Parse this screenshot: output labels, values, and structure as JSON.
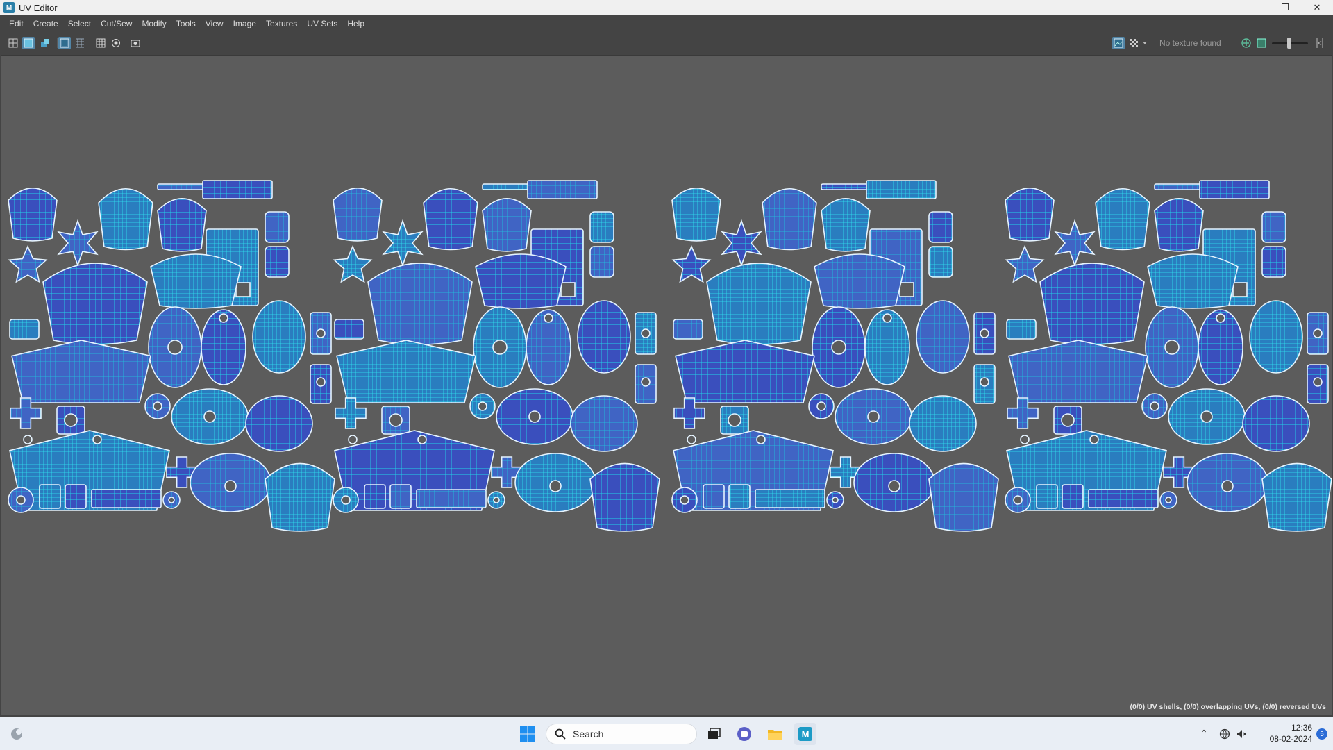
{
  "window": {
    "title": "UV Editor"
  },
  "window_controls": {
    "minimize": "—",
    "restore": "❐",
    "close": "✕"
  },
  "menu": [
    "Edit",
    "Create",
    "Select",
    "Cut/Sew",
    "Modify",
    "Tools",
    "View",
    "Image",
    "Textures",
    "UV Sets",
    "Help"
  ],
  "toolbar": {
    "texture_status": "No texture found"
  },
  "viewport": {
    "status": "(0/0) UV shells, (0/0) overlapping UVs, (0/0) reversed UVs"
  },
  "colors": {
    "uv_fill": "#3a4fbd",
    "uv_wire": "#22d3e6",
    "uv_border": "#e6f4ff",
    "viewport_bg": "#5c5c5c"
  },
  "taskbar": {
    "search_placeholder": "Search",
    "time": "12:36",
    "date": "08-02-2024",
    "notifications": "5"
  }
}
